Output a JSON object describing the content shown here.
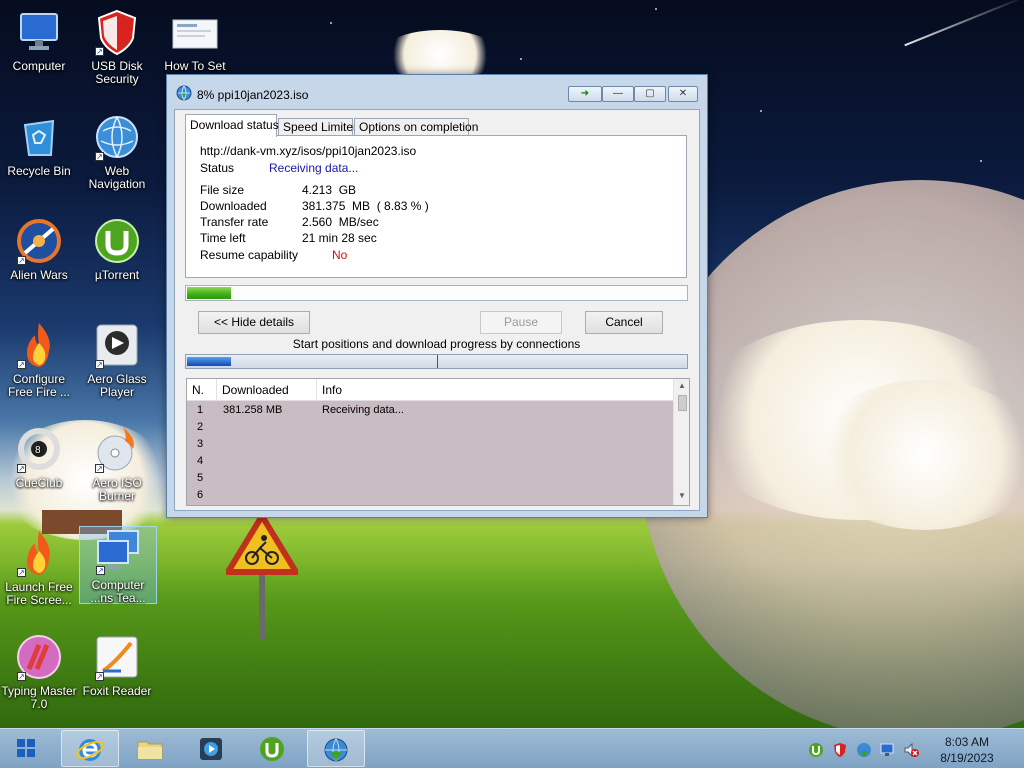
{
  "desktop": {
    "icons": [
      {
        "label": "Computer"
      },
      {
        "label": "USB Disk Security"
      },
      {
        "label": "How To Set B..."
      },
      {
        "label": "Recycle Bin"
      },
      {
        "label": "Web Navigation"
      },
      {
        "label": "Alien Wars"
      },
      {
        "label": "µTorrent"
      },
      {
        "label": "Configure Free Fire ..."
      },
      {
        "label": "Aero Glass Player"
      },
      {
        "label": "CueClub"
      },
      {
        "label": "Aero ISO Burner"
      },
      {
        "label": "Launch Free Fire Scree..."
      },
      {
        "label": "Computer ...ns Tea..."
      },
      {
        "label": "Typing Master 7.0"
      },
      {
        "label": "Foxit Reader"
      }
    ]
  },
  "download_window": {
    "title": "8% ppi10jan2023.iso",
    "tabs": [
      "Download status",
      "Speed Limiter",
      "Options on completion"
    ],
    "url": "http://dank-vm.xyz/isos/ppi10jan2023.iso",
    "status_label": "Status",
    "status_value": "Receiving data...",
    "fields": [
      {
        "label": "File size",
        "value": "4.213  GB"
      },
      {
        "label": "Downloaded",
        "value": "381.375  MB  ( 8.83 % )"
      },
      {
        "label": "Transfer rate",
        "value": "2.560  MB/sec"
      },
      {
        "label": "Time left",
        "value": "21 min 28 sec"
      }
    ],
    "resume_label": "Resume capability",
    "resume_value": "No",
    "progress_fraction": 0.0883,
    "buttons": {
      "hide_details": "<< Hide details",
      "pause": "Pause",
      "cancel": "Cancel"
    },
    "connections_caption": "Start positions and download progress by connections",
    "connection_progress_fraction": 0.0883,
    "connection_marker_fraction": 0.5,
    "table": {
      "headers": [
        "N.",
        "Downloaded",
        "Info"
      ],
      "rows": [
        {
          "n": "1",
          "downloaded": "381.258  MB",
          "info": "Receiving data..."
        },
        {
          "n": "2",
          "downloaded": "",
          "info": ""
        },
        {
          "n": "3",
          "downloaded": "",
          "info": ""
        },
        {
          "n": "4",
          "downloaded": "",
          "info": ""
        },
        {
          "n": "5",
          "downloaded": "",
          "info": ""
        },
        {
          "n": "6",
          "downloaded": "",
          "info": ""
        }
      ]
    }
  },
  "taskbar": {
    "clock_time": "8:03 AM",
    "clock_date": "8/19/2023"
  },
  "colors": {
    "accent_green": "#3fae17",
    "status_blue": "#1818a8",
    "status_red": "#d41010"
  }
}
